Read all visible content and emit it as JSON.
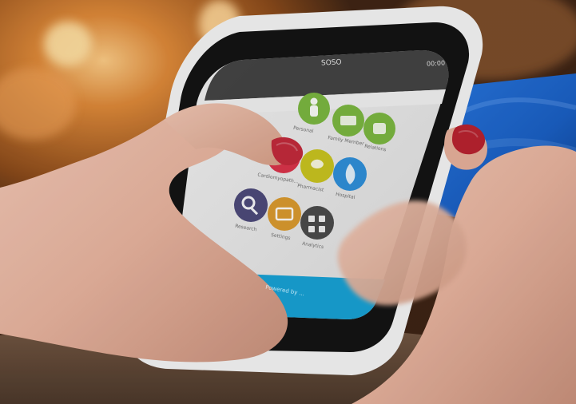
{
  "scene": {
    "description_colors": {
      "background_warm": "#b86a2a",
      "table": "#6e5442",
      "phone_body": "#f1f1f1",
      "phone_screen_bg": "#e6e6e6",
      "phone_accent_blue": "#1aa6d6",
      "card_blue": "#1f6fd6"
    }
  },
  "phone": {
    "status_time": "00:00",
    "app_header_left": "SOSO",
    "footer_text": "Powered by ...",
    "icons": [
      {
        "name": "person-icon",
        "label": "Personal",
        "color": "#7bb640"
      },
      {
        "name": "group-icon",
        "label": "Family Member",
        "color": "#7bb640"
      },
      {
        "name": "couple-icon",
        "label": "Relations",
        "color": "#7bb640"
      },
      {
        "name": "heart-icon",
        "label": "Cardiomyopath...",
        "color": "#d9334a"
      },
      {
        "name": "pill-icon",
        "label": "Pharmacist",
        "color": "#c8c31f"
      },
      {
        "name": "flame-icon",
        "label": "Hospital",
        "color": "#2f8fd8"
      },
      {
        "name": "search-icon",
        "label": "Research",
        "color": "#4d4a7a"
      },
      {
        "name": "sliders-icon",
        "label": "Settings",
        "color": "#d9992e"
      },
      {
        "name": "grid-icon",
        "label": "Analytics",
        "color": "#4b4b4b"
      }
    ]
  }
}
